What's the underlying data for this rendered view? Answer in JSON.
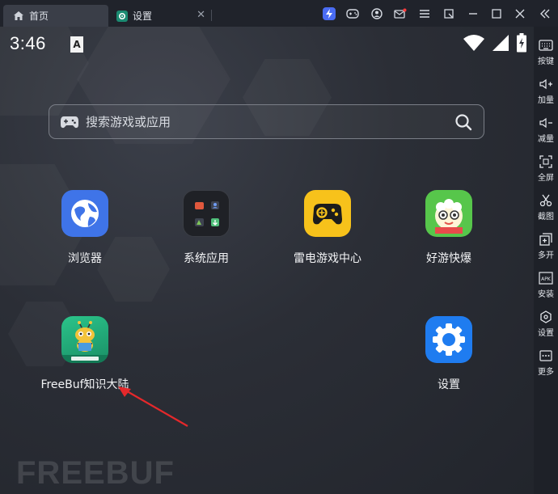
{
  "tabs": [
    {
      "label": "首页",
      "icon": "home-icon"
    },
    {
      "label": "设置",
      "icon": "settings-app-icon"
    }
  ],
  "toolbar_icons": [
    "booster-icon",
    "gamepad-icon",
    "account-icon",
    "mail-icon",
    "restore-window-icon",
    "minimize-icon",
    "maximize-icon",
    "close-icon",
    "collapse-icon"
  ],
  "status": {
    "time": "3:46",
    "notification_letter": "A"
  },
  "search": {
    "placeholder": "搜索游戏或应用"
  },
  "apps": [
    {
      "label": "浏览器",
      "icon": "browser-icon",
      "color": "#3f74e8"
    },
    {
      "label": "系统应用",
      "icon": "system-apps-folder-icon",
      "color": "#1f2126"
    },
    {
      "label": "雷电游戏中心",
      "icon": "game-center-icon",
      "color": "#f7c21b"
    },
    {
      "label": "好游快爆",
      "icon": "haoyou-kuaibao-icon",
      "color": "#57c64b"
    },
    {
      "label": "FreeBuf知识大陆",
      "icon": "freebuf-app-icon",
      "color": "#25b07c"
    },
    {
      "label": "设置",
      "icon": "settings-gear-icon",
      "color": "#1f7cf0"
    }
  ],
  "sidebar": [
    {
      "label": "按键",
      "icon": "keyboard-icon"
    },
    {
      "label": "加量",
      "icon": "volume-up-icon"
    },
    {
      "label": "减量",
      "icon": "volume-down-icon"
    },
    {
      "label": "全屏",
      "icon": "fullscreen-icon"
    },
    {
      "label": "截图",
      "icon": "scissors-icon"
    },
    {
      "label": "多开",
      "icon": "multi-instance-icon"
    },
    {
      "label": "安装",
      "icon": "apk-install-icon"
    },
    {
      "label": "设置",
      "icon": "settings-hex-icon"
    },
    {
      "label": "更多",
      "icon": "more-icon"
    }
  ],
  "watermark": "FREEBUF"
}
